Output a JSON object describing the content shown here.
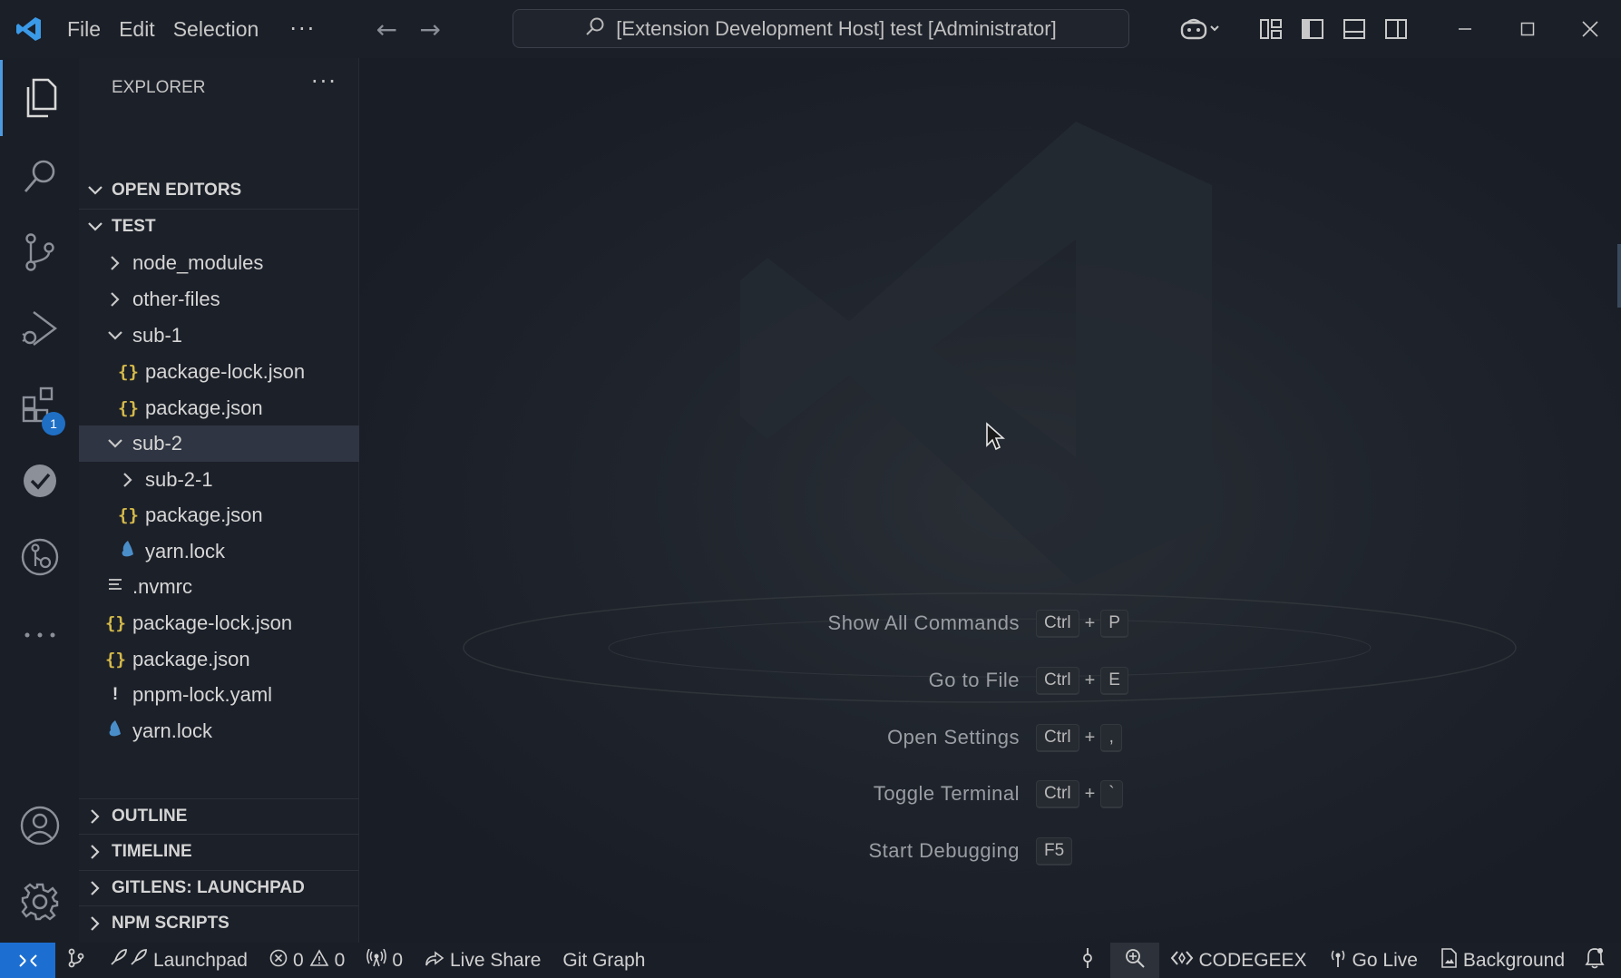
{
  "titlebar": {
    "menus": [
      "File",
      "Edit",
      "Selection"
    ],
    "command_center": "[Extension Development Host] test [Administrator]"
  },
  "activitybar": {
    "extensions_badge": "1"
  },
  "sidebar": {
    "title": "EXPLORER",
    "open_editors": "OPEN EDITORS",
    "folder": "TEST",
    "tree": [
      {
        "label": "node_modules",
        "kind": "folder-collapsed"
      },
      {
        "label": "other-files",
        "kind": "folder-collapsed"
      },
      {
        "label": "sub-1",
        "kind": "folder-expanded"
      },
      {
        "label": "package-lock.json",
        "kind": "json"
      },
      {
        "label": "package.json",
        "kind": "json"
      },
      {
        "label": "sub-2",
        "kind": "folder-expanded"
      },
      {
        "label": "sub-2-1",
        "kind": "folder-collapsed"
      },
      {
        "label": "package.json",
        "kind": "json"
      },
      {
        "label": "yarn.lock",
        "kind": "yarn"
      },
      {
        "label": ".nvmrc",
        "kind": "text"
      },
      {
        "label": "package-lock.json",
        "kind": "json"
      },
      {
        "label": "package.json",
        "kind": "json"
      },
      {
        "label": "pnpm-lock.yaml",
        "kind": "yaml"
      },
      {
        "label": "yarn.lock",
        "kind": "yarn"
      }
    ],
    "sections": [
      "OUTLINE",
      "TIMELINE",
      "GITLENS: LAUNCHPAD",
      "NPM SCRIPTS"
    ]
  },
  "editor": {
    "shortcuts": [
      {
        "label": "Show All Commands",
        "keys": [
          "Ctrl",
          "P"
        ]
      },
      {
        "label": "Go to File",
        "keys": [
          "Ctrl",
          "E"
        ]
      },
      {
        "label": "Open Settings",
        "keys": [
          "Ctrl",
          ","
        ]
      },
      {
        "label": "Toggle Terminal",
        "keys": [
          "Ctrl",
          "`"
        ]
      },
      {
        "label": "Start Debugging",
        "keys": [
          "F5"
        ]
      }
    ],
    "plus": "+"
  },
  "statusbar": {
    "launchpad": "Launchpad",
    "errors": "0",
    "warnings": "0",
    "ports": "0",
    "live_share": "Live Share",
    "git_graph": "Git Graph",
    "codegeex": "CODEGEEX",
    "go_live": "Go Live",
    "background": "Background"
  },
  "colors": {
    "accent": "#1c6fd1",
    "json_icon": "#d4b94a",
    "yarn_icon": "#4a8ec9"
  }
}
